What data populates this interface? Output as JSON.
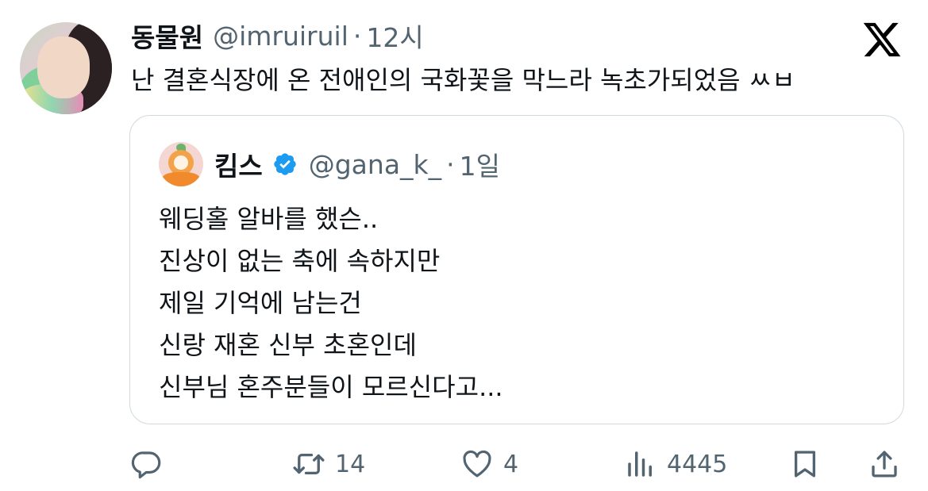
{
  "tweet": {
    "display_name": "동물원",
    "handle": "@imruiruil",
    "separator": "·",
    "time": "12시",
    "text": "난 결혼식장에 온 전애인의 국화꽃을 막느라 녹초가되었음 ㅆㅂ"
  },
  "quoted": {
    "display_name": "킴스",
    "handle": "@gana_k_",
    "separator": "·",
    "time": "1일",
    "lines": [
      "웨딩홀 알바를 했슨..",
      "진상이 없는 축에 속하지만",
      "제일 기억에 남는건",
      "신랑 재혼 신부 초혼인데",
      "신부님 혼주분들이 모르신다고..."
    ]
  },
  "actions": {
    "reply_count": "",
    "retweet_count": "14",
    "like_count": "4",
    "view_count": "4445"
  },
  "icons": {
    "brand": "x-logo-icon",
    "verified": "verified-badge-icon",
    "reply": "reply-icon",
    "retweet": "retweet-icon",
    "like": "heart-icon",
    "views": "views-icon",
    "bookmark": "bookmark-icon",
    "share": "share-icon"
  },
  "colors": {
    "text": "#0f1419",
    "secondary": "#536471",
    "border": "#cfd9de",
    "verified": "#1d9bf0"
  }
}
